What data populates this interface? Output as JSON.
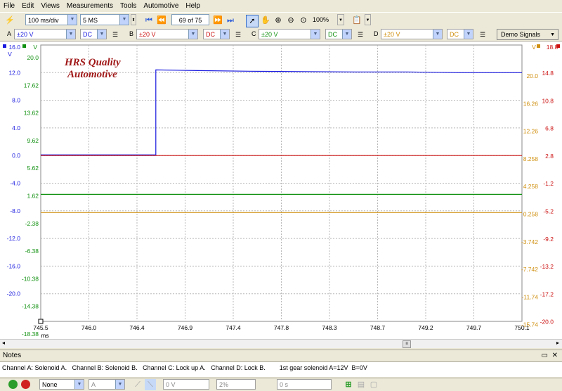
{
  "menu": [
    "File",
    "Edit",
    "Views",
    "Measurements",
    "Tools",
    "Automotive",
    "Help"
  ],
  "toolbar": {
    "timebase": "100 ms/div",
    "samples": "5 MS",
    "buffer": "69 of 75",
    "zoom": "100%"
  },
  "channels": [
    {
      "letter": "A",
      "range": "±20 V",
      "coupling": "DC",
      "color": "#1a1ae0"
    },
    {
      "letter": "B",
      "range": "±20 V",
      "coupling": "DC",
      "color": "#cc1010"
    },
    {
      "letter": "C",
      "range": "±20 V",
      "coupling": "DC",
      "color": "#109010"
    },
    {
      "letter": "D",
      "range": "±20 V",
      "coupling": "DC",
      "color": "#d09010"
    }
  ],
  "demo_signals": "Demo Signals",
  "watermark": {
    "line1": "HRS Quality",
    "line2": "Automotive"
  },
  "axes": {
    "left_a_top": "16.0",
    "left_a_unit": "V",
    "left_c_unit": "V",
    "right_d_unit": "V",
    "right_b_top": "18.8",
    "x_unit": "ms",
    "left_a": [
      "12.0",
      "8.0",
      "4.0",
      "0.0",
      "-4.0",
      "-8.0",
      "-12.0",
      "-16.0",
      "-20.0"
    ],
    "left_c": [
      "20.0",
      "17.62",
      "13.62",
      "9.62",
      "5.62",
      "1.62",
      "-2.38",
      "-6.38",
      "-10.38",
      "-14.38",
      "-18.38"
    ],
    "right_d": [
      "20.0",
      "16.26",
      "12.26",
      "8.258",
      "4.258",
      "0.258",
      "-3.742",
      "-7.742",
      "-11.74",
      "-15.74"
    ],
    "right_b": [
      "14.8",
      "10.8",
      "6.8",
      "2.8",
      "-1.2",
      "-5.2",
      "-9.2",
      "-13.2",
      "-17.2",
      "-20.0"
    ],
    "x_ticks": [
      "745.5",
      "746.0",
      "746.4",
      "746.9",
      "747.4",
      "747.8",
      "748.3",
      "748.7",
      "749.2",
      "749.7",
      "750.1"
    ]
  },
  "chart_data": {
    "type": "line",
    "xlim": [
      745.5,
      750.1
    ],
    "series": [
      {
        "channel": "A",
        "color": "#1a1ae0",
        "x": [
          745.5,
          746.6,
          746.6,
          747.0,
          747.5,
          748.0,
          748.5,
          749.0,
          749.5,
          750.1
        ],
        "y": [
          0.1,
          0.1,
          12.4,
          12.3,
          12.2,
          12.15,
          12.1,
          12.1,
          12.0,
          12.0
        ]
      },
      {
        "channel": "B",
        "color": "#cc1010",
        "x": [
          745.5,
          750.1
        ],
        "y": [
          2.8,
          2.8
        ]
      },
      {
        "channel": "C",
        "color": "#109010",
        "x": [
          745.5,
          750.1
        ],
        "y": [
          0.0,
          0.0
        ]
      },
      {
        "channel": "D",
        "color": "#d09010",
        "x": [
          745.5,
          750.1
        ],
        "y": [
          0.0,
          0.0
        ]
      }
    ],
    "grid": true
  },
  "notes": {
    "title": "Notes",
    "text": "Channel A: Solenoid A.   Channel B: Solenoid B.   Channel C: Lock up A.   Channel D: Lock B.        1st gear solenoid A=12V  B=0V"
  },
  "bottom": {
    "trigger": "None",
    "channel": "A",
    "level": "0 V",
    "pretrigger": "2%",
    "delay": "0 s"
  }
}
